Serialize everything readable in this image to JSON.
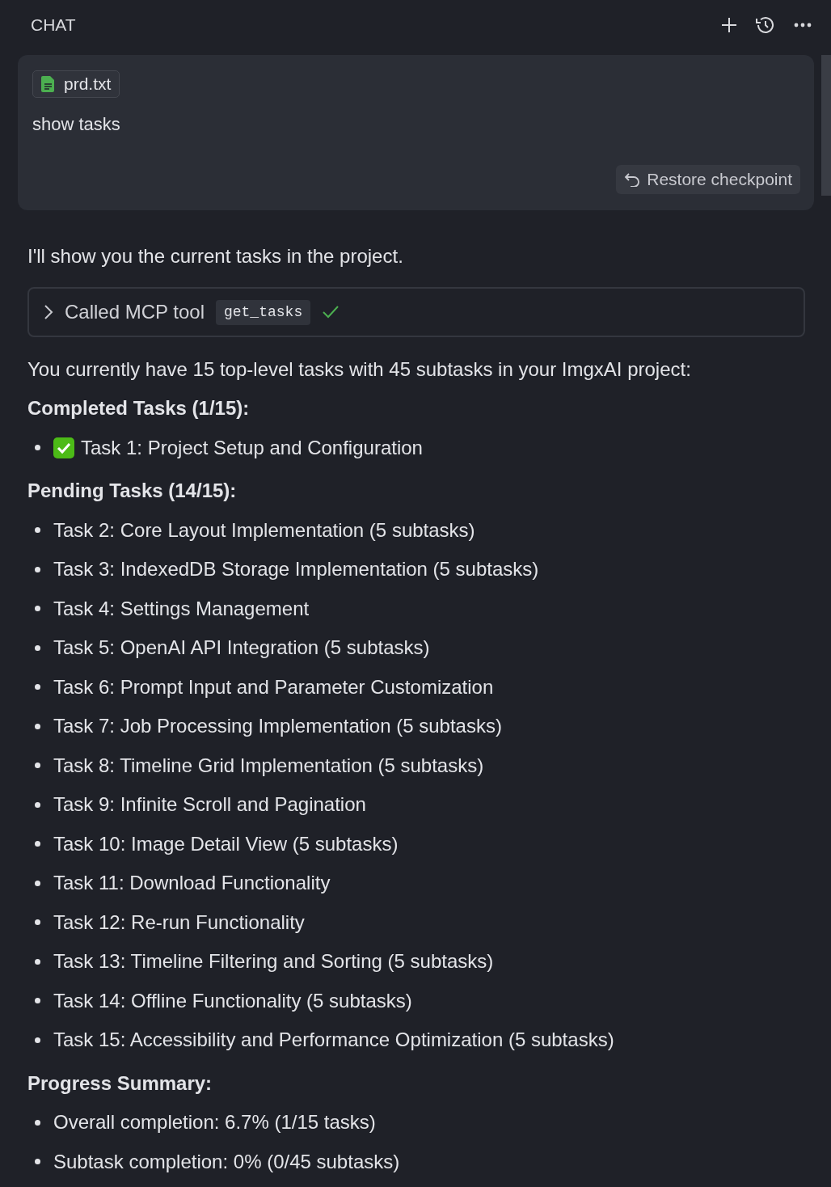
{
  "header": {
    "title": "CHAT"
  },
  "user_message": {
    "attachment": "prd.txt",
    "text": "show tasks",
    "restore_button": "Restore checkpoint"
  },
  "response": {
    "intro": "I'll show you the current tasks in the project.",
    "tool_call": {
      "label": "Called MCP tool",
      "tool": "get_tasks",
      "expanded": false,
      "success": true
    },
    "summary": "You currently have 15 top-level tasks with 45 subtasks in your ImgxAI project:",
    "sections": [
      {
        "heading": "Completed Tasks (1/15):",
        "items": [
          {
            "text": "Task 1: Project Setup and Configuration",
            "done": true
          }
        ]
      },
      {
        "heading": "Pending Tasks (14/15):",
        "items": [
          {
            "text": "Task 2: Core Layout Implementation (5 subtasks)",
            "done": false
          },
          {
            "text": "Task 3: IndexedDB Storage Implementation (5 subtasks)",
            "done": false
          },
          {
            "text": "Task 4: Settings Management",
            "done": false
          },
          {
            "text": "Task 5: OpenAI API Integration (5 subtasks)",
            "done": false
          },
          {
            "text": "Task 6: Prompt Input and Parameter Customization",
            "done": false
          },
          {
            "text": "Task 7: Job Processing Implementation (5 subtasks)",
            "done": false
          },
          {
            "text": "Task 8: Timeline Grid Implementation (5 subtasks)",
            "done": false
          },
          {
            "text": "Task 9: Infinite Scroll and Pagination",
            "done": false
          },
          {
            "text": "Task 10: Image Detail View (5 subtasks)",
            "done": false
          },
          {
            "text": "Task 11: Download Functionality",
            "done": false
          },
          {
            "text": "Task 12: Re-run Functionality",
            "done": false
          },
          {
            "text": "Task 13: Timeline Filtering and Sorting (5 subtasks)",
            "done": false
          },
          {
            "text": "Task 14: Offline Functionality (5 subtasks)",
            "done": false
          },
          {
            "text": "Task 15: Accessibility and Performance Optimization (5 subtasks)",
            "done": false
          }
        ]
      },
      {
        "heading": "Progress Summary:",
        "items": [
          {
            "text": "Overall completion: 6.7% (1/15 tasks)",
            "done": false
          },
          {
            "text": "Subtask completion: 0% (0/45 subtasks)",
            "done": false
          }
        ]
      }
    ]
  }
}
